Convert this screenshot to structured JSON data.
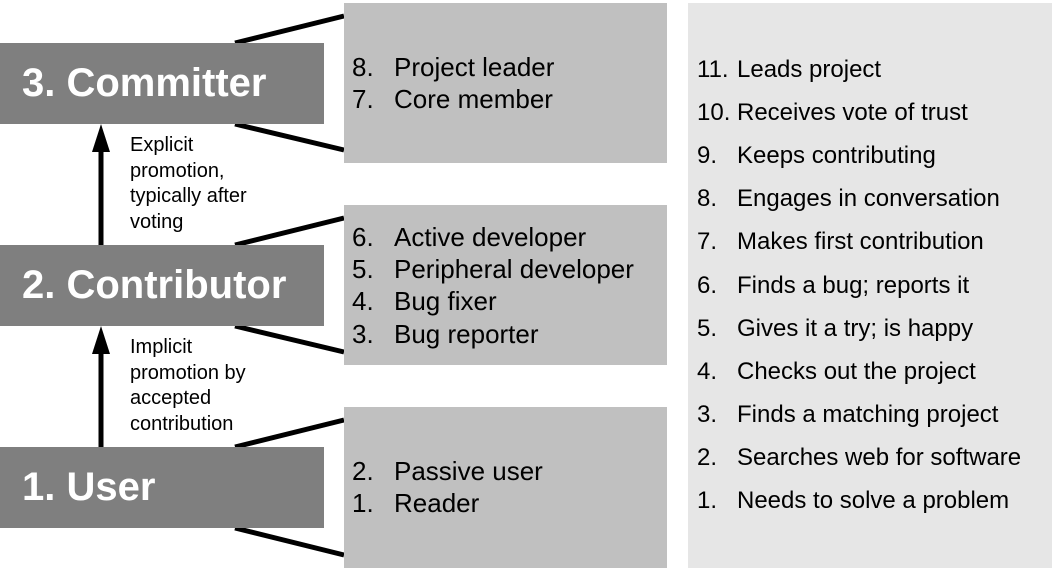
{
  "roles": [
    {
      "label": "3. Committer"
    },
    {
      "label": "2. Contributor"
    },
    {
      "label": "1. User"
    }
  ],
  "promotions": [
    {
      "lines": [
        "Explicit",
        "promotion,",
        "typically after",
        "voting"
      ]
    },
    {
      "lines": [
        "Implicit",
        "promotion by",
        "accepted",
        "contribution"
      ]
    }
  ],
  "groups": [
    {
      "items": [
        {
          "num": "8.",
          "text": "Project leader"
        },
        {
          "num": "7.",
          "text": "Core member"
        }
      ]
    },
    {
      "items": [
        {
          "num": "6.",
          "text": "Active developer"
        },
        {
          "num": "5.",
          "text": "Peripheral developer"
        },
        {
          "num": "4.",
          "text": "Bug fixer"
        },
        {
          "num": "3.",
          "text": "Bug reporter"
        }
      ]
    },
    {
      "items": [
        {
          "num": "2.",
          "text": "Passive user"
        },
        {
          "num": "1.",
          "text": "Reader"
        }
      ]
    }
  ],
  "steps": [
    {
      "num": "11.",
      "text": "Leads project"
    },
    {
      "num": "10.",
      "text": "Receives vote of trust"
    },
    {
      "num": "9.",
      "text": "Keeps contributing"
    },
    {
      "num": "8.",
      "text": "Engages in conversation"
    },
    {
      "num": "7.",
      "text": "Makes first contribution"
    },
    {
      "num": "6.",
      "text": "Finds a bug; reports it"
    },
    {
      "num": "5.",
      "text": "Gives it a try; is happy"
    },
    {
      "num": "4.",
      "text": "Checks out the project"
    },
    {
      "num": "3.",
      "text": "Finds a matching project"
    },
    {
      "num": "2.",
      "text": "Searches web for software"
    },
    {
      "num": "1.",
      "text": "Needs to solve a problem"
    }
  ],
  "colors": {
    "role_box": "#7f7f7f",
    "group_box": "#c0c0c0",
    "steps_box": "#e6e6e6"
  }
}
